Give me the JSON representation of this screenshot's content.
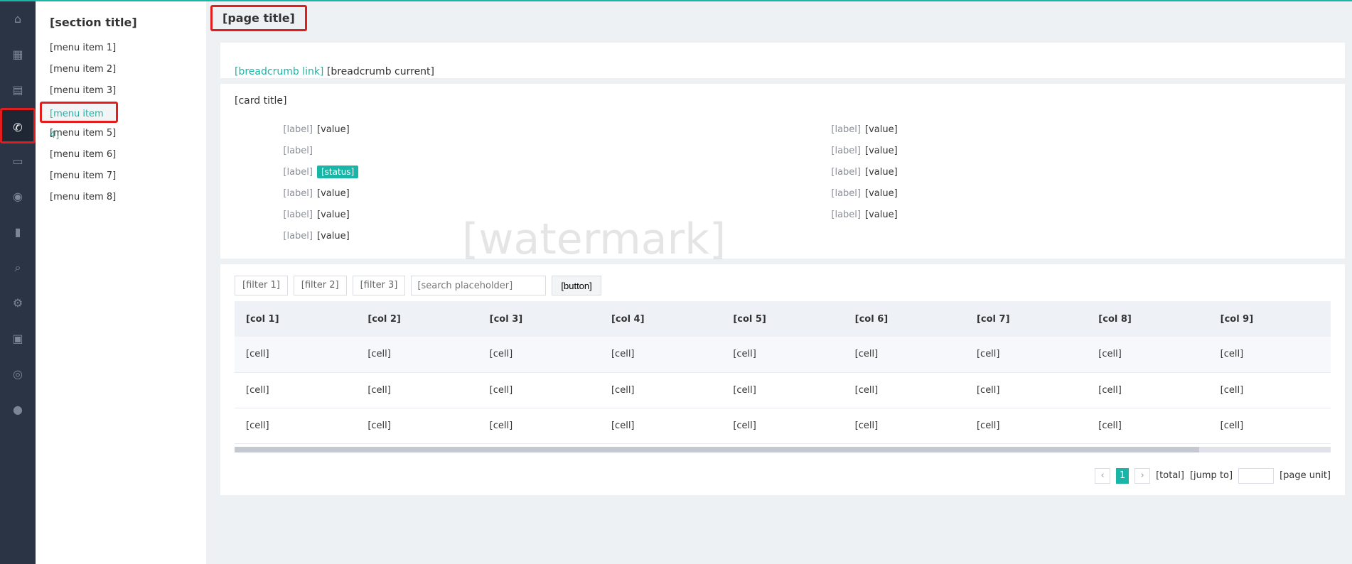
{
  "rail": {
    "icons": [
      "home-icon",
      "grid-icon",
      "document-icon",
      "phone-icon",
      "chat-icon",
      "users-icon",
      "chart-icon",
      "search-icon",
      "gear-icon",
      "report-icon",
      "settings-icon",
      "user-icon"
    ],
    "active_index": 3
  },
  "subnav": {
    "title": "[section title]",
    "items": [
      "[menu item 1]",
      "[menu item 2]",
      "[menu item 3]",
      "[menu item 4]",
      "[menu item 5]",
      "[menu item 6]",
      "[menu item 7]",
      "[menu item 8]"
    ],
    "active_index": 3
  },
  "header": {
    "title": "[page title]"
  },
  "breadcrumb": {
    "link": "[breadcrumb link]",
    "current": "[breadcrumb current]"
  },
  "info": {
    "title": "[card title]",
    "left": [
      {
        "label": "[label]",
        "value": "[value]"
      },
      {
        "label": "[label]",
        "value": ""
      },
      {
        "label": "[label]",
        "value": "[status]",
        "badge": true
      },
      {
        "label": "[label]",
        "value": "[value]"
      },
      {
        "label": "[label]",
        "value": "[value]"
      },
      {
        "label": "[label]",
        "value": "[value]"
      }
    ],
    "right": [
      {
        "label": "[label]",
        "value": "[value]"
      },
      {
        "label": "[label]",
        "value": "[value]"
      },
      {
        "label": "[label]",
        "value": "[value]"
      },
      {
        "label": "[label]",
        "value": "[value]"
      },
      {
        "label": "[label]",
        "value": "[value]"
      }
    ]
  },
  "filters": {
    "selects": [
      "[filter 1]",
      "[filter 2]",
      "[filter 3]"
    ],
    "search_placeholder": "[search placeholder]",
    "search_button": "[button]"
  },
  "table": {
    "headers": [
      "[col 1]",
      "[col 2]",
      "[col 3]",
      "[col 4]",
      "[col 5]",
      "[col 6]",
      "[col 7]",
      "[col 8]",
      "[col 9]"
    ],
    "rows": [
      [
        "[cell]",
        "[cell]",
        "[cell]",
        "[cell]",
        "[cell]",
        "[cell]",
        "[cell]",
        "[cell]",
        "[cell]"
      ],
      [
        "[cell]",
        "[cell]",
        "[cell]",
        "[cell]",
        "[cell]",
        "[cell]",
        "[cell]",
        "[cell]",
        "[cell]"
      ],
      [
        "[cell]",
        "[cell]",
        "[cell]",
        "[cell]",
        "[cell]",
        "[cell]",
        "[cell]",
        "[cell]",
        "[cell]"
      ]
    ],
    "highlight_columns": [
      5,
      6,
      7,
      8
    ]
  },
  "pager": {
    "prev": "‹",
    "next": "›",
    "current_page": "1",
    "total_text": "[total]",
    "jump_text": "[jump to]",
    "page_unit": "[page unit]"
  },
  "watermark": {
    "text": "[watermark]"
  },
  "colors": {
    "accent": "#19b6a8",
    "rail": "#2b3445",
    "highlight": "#e11d1d"
  }
}
